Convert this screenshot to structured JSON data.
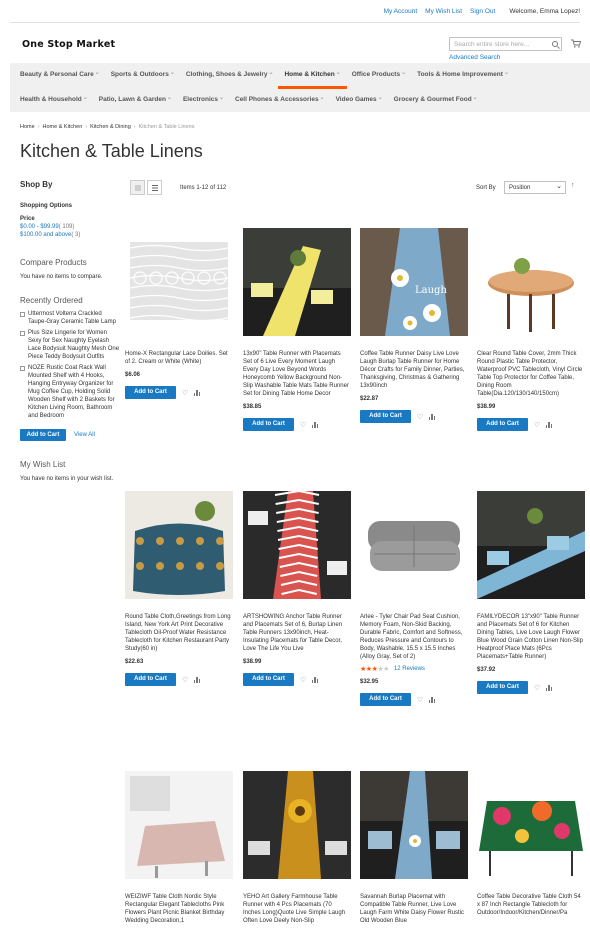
{
  "header": {
    "links": [
      "My Account",
      "My Wish List",
      "Sign Out"
    ],
    "welcome": "Welcome, Emma Lopez!",
    "logo": "One Stop Market",
    "search_placeholder": "Search entire store here...",
    "advanced_search": "Advanced Search"
  },
  "nav": {
    "row1": [
      "Beauty & Personal Care",
      "Sports & Outdoors",
      "Clothing, Shoes & Jewelry",
      "Home & Kitchen",
      "Office Products",
      "Tools & Home Improvement"
    ],
    "row2": [
      "Health & Household",
      "Patio, Lawn & Garden",
      "Electronics",
      "Cell Phones & Accessories",
      "Video Games",
      "Grocery & Gourmet Food"
    ],
    "active": "Home & Kitchen"
  },
  "breadcrumb": [
    "Home",
    "Home & Kitchen",
    "Kitchen & Dining",
    "Kitchen & Table Linens"
  ],
  "page_title": "Kitchen & Table Linens",
  "sidebar": {
    "shop_by": "Shop By",
    "shopping_options": "Shopping Options",
    "price_label": "Price",
    "price_ranges": [
      {
        "label": "$0.00 - $99.99",
        "count": "( 109)"
      },
      {
        "label": "$100.00 and above",
        "count": "( 3)"
      }
    ],
    "compare_title": "Compare Products",
    "compare_text": "You have no items to compare.",
    "recent_title": "Recently Ordered",
    "recent_items": [
      "Uttermost Volterra Crackled Taupe-Gray Ceramic Table Lamp",
      "Plus Size Lingerie for Women Sexy for Sex Naughty Eyelash Lace Bodysuit Naughty Mesh One Piece Teddy Bodysuit Outfits",
      "NOZE Rustic Coat Rack Wall Mounted Shelf with 4 Hooks, Hanging Entryway Organizer for Mug Coffee Cup, Holding Solid Wooden Shelf with 2 Baskets for Kitchen Living Room, Bathroom and Bedroom"
    ],
    "add_to_cart": "Add to Cart",
    "view_all": "View All",
    "wishlist_title": "My Wish List",
    "wishlist_text": "You have no items in your wish list."
  },
  "toolbar": {
    "items_count": "Items 1-12 of 112",
    "sort_by": "Sort By",
    "sort_value": "Position",
    "sort_dir_icon": "arrow-up-icon"
  },
  "products": [
    {
      "name": "Home-X Rectangular Lace Doilies. Set of 2. Cream or White (White)",
      "price": "$6.06",
      "button": "Add to Cart"
    },
    {
      "name": "13x90\" Table Runner with Placemats Set of 6 Live Every Moment Laugh Every Day Love Beyond Words Honeycomb Yellow Background Non-Slip Washable Table Mats Table Runner Set for Dining Table Home Decor",
      "price": "$38.85",
      "button": "Add to Cart"
    },
    {
      "name": "Coffee Table Runner Daisy Live Love Laugh Burlap Table Runner for Home Décor Crafts for Family Dinner, Parties, Thanksgiving, Christmas & Gathering 13x90inch",
      "price": "$22.87",
      "button": "Add to Cart"
    },
    {
      "name": "Clear Round Table Cover, 2mm Thick Round Plastic Table Protector, Waterproof PVC Tablecloth, Vinyl Circle Table Top Protector for Coffee Table, Dining Room Table(Dia.120/130/140/150cm)",
      "price": "$38.99",
      "button": "Add to Cart"
    },
    {
      "name": "Round Table Cloth,Greetings from Long Island, New York Art Print Decorative Tablecloth Oil-Proof Water Resistance Tablecloth for Kitchen Restaurant Party Study(60 in)",
      "price": "$22.63",
      "button": "Add to Cart"
    },
    {
      "name": "ARTSHOWING Anchor Table Runner and Placemats Set of 6, Burlap Linen Table Runners 13x90inch, Heat-Insulating Placemats for Table Decor, Love The Life You Live",
      "price": "$38.99",
      "button": "Add to Cart"
    },
    {
      "name": "Arlee - Tyler Chair Pad Seat Cushion, Memory Foam, Non-Skid Backing, Durable Fabric, Comfort and Softness, Reduces Pressure and Contours to Body, Washable, 15.5 x 15.5 Inches (Alloy Gray, Set of 2)",
      "price": "$32.95",
      "button": "Add to Cart",
      "rating": 0.6,
      "reviews": "12  Reviews"
    },
    {
      "name": "FAMILYDECOR 13\"x90\" Table Runner and Placemats Set of 6 for Kitchen Dining Tables, Live Love Laugh Flower Blue Wood Grain Cotton Linen Non-Slip Heatproof Place Mats (6Pcs Placemats+Table Runner)",
      "price": "$37.92",
      "button": "Add to Cart"
    },
    {
      "name": "WEIZIWF Table Cloth Nordic Style Rectangular Elegant Tablecloths Pink Flowers Plant Picnic Blanket Birthday Wedding Decoration,1"
    },
    {
      "name": "YEHO Art Gallery Farmhouse Table Runner with 4 Pcs Placemats (70 Inches Long)Quote Live Simple Laugh Often Love Deely Non-Slip"
    },
    {
      "name": "Savannah Burlap Placemat with Compatible Table Runner, Live Love Laugh Farm White Daisy Flower Rustic Old Wooden Blue"
    },
    {
      "name": "Coffee Table Decorative Table Cloth 54 x 87 Inch Rectangle Tablecloth for Outdoor/Indoor/Kitchen/Dinner/Pa"
    }
  ]
}
